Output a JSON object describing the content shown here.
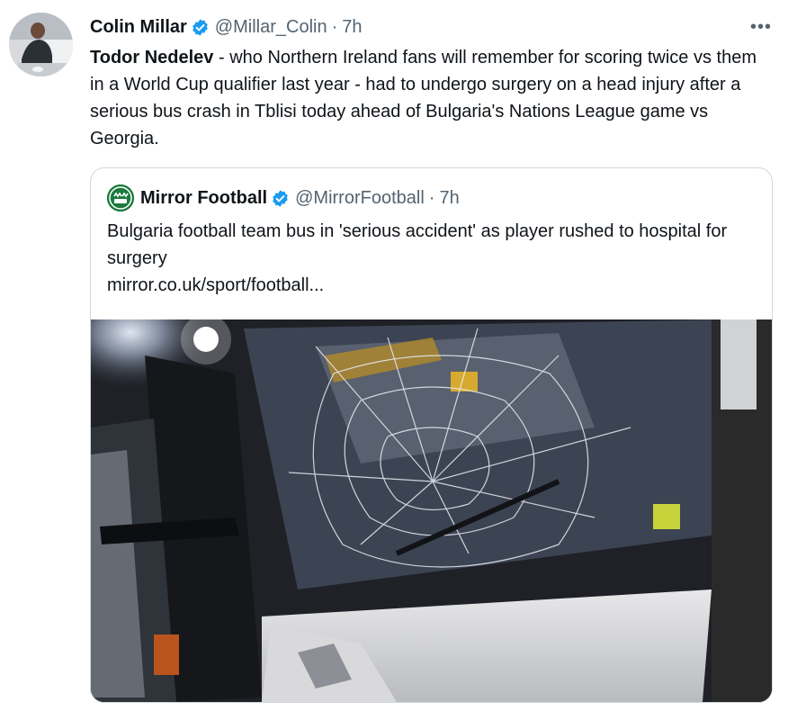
{
  "tweet": {
    "author_name": "Colin Millar",
    "author_handle": "@Millar_Colin",
    "separator": "·",
    "time": "7h",
    "more_label": "•••",
    "body_bold": "Todor Nedelev",
    "body_rest": " - who Northern Ireland fans will remember for scoring twice vs them in a World Cup qualifier last year - had to undergo surgery on a head injury after a serious bus crash in Tblisi today ahead of Bulgaria's Nations League game vs Georgia."
  },
  "quoted": {
    "author_name": "Mirror Football",
    "author_handle": "@MirrorFootball",
    "separator": "·",
    "time": "7h",
    "text_line1": "Bulgaria football team bus in 'serious accident' as player rushed to hospital for surgery",
    "link": "mirror.co.uk/sport/football..."
  },
  "colors": {
    "verified": "#1d9bf0",
    "secondary_text": "#536471",
    "border": "#cfd9de",
    "mirror_green": "#1b7a3e"
  }
}
